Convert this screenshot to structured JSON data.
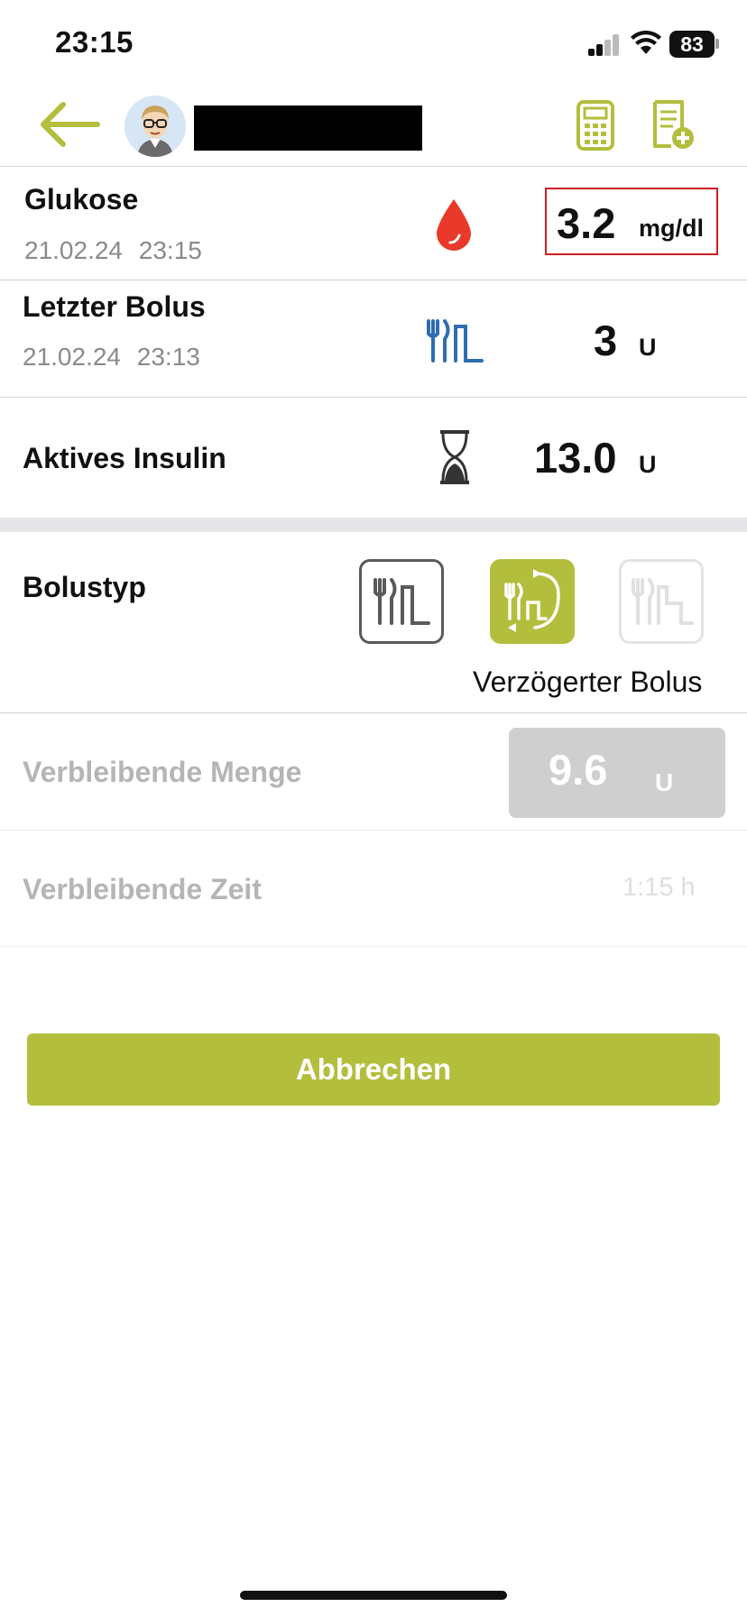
{
  "status_bar": {
    "time": "23:15",
    "battery": "83"
  },
  "header": {
    "back_icon": "arrow-left-icon",
    "calculator_icon": "calculator-icon",
    "log_icon": "add-entry-icon"
  },
  "glucose": {
    "label": "Glukose",
    "date": "21.02.24",
    "time": "23:15",
    "value": "3.2",
    "unit": "mg/dl"
  },
  "last_bolus": {
    "label": "Letzter Bolus",
    "date": "21.02.24",
    "time": "23:13",
    "value": "3",
    "unit": "U"
  },
  "active_insulin": {
    "label": "Aktives Insulin",
    "value": "13.0",
    "unit": "U"
  },
  "bolus_type": {
    "label": "Bolustyp",
    "selected_label": "Verzögerter Bolus"
  },
  "remaining_amount": {
    "label": "Verbleibende Menge",
    "value": "9.6",
    "unit": "U"
  },
  "remaining_time": {
    "label": "Verbleibende Zeit",
    "value": "1:15 h"
  },
  "cancel_button": {
    "label": "Abbrechen"
  },
  "colors": {
    "accent": "#b3be3d",
    "drop": "#e8392a",
    "bolus_icon": "#2f6db1",
    "alert_border": "#cc1f24"
  }
}
